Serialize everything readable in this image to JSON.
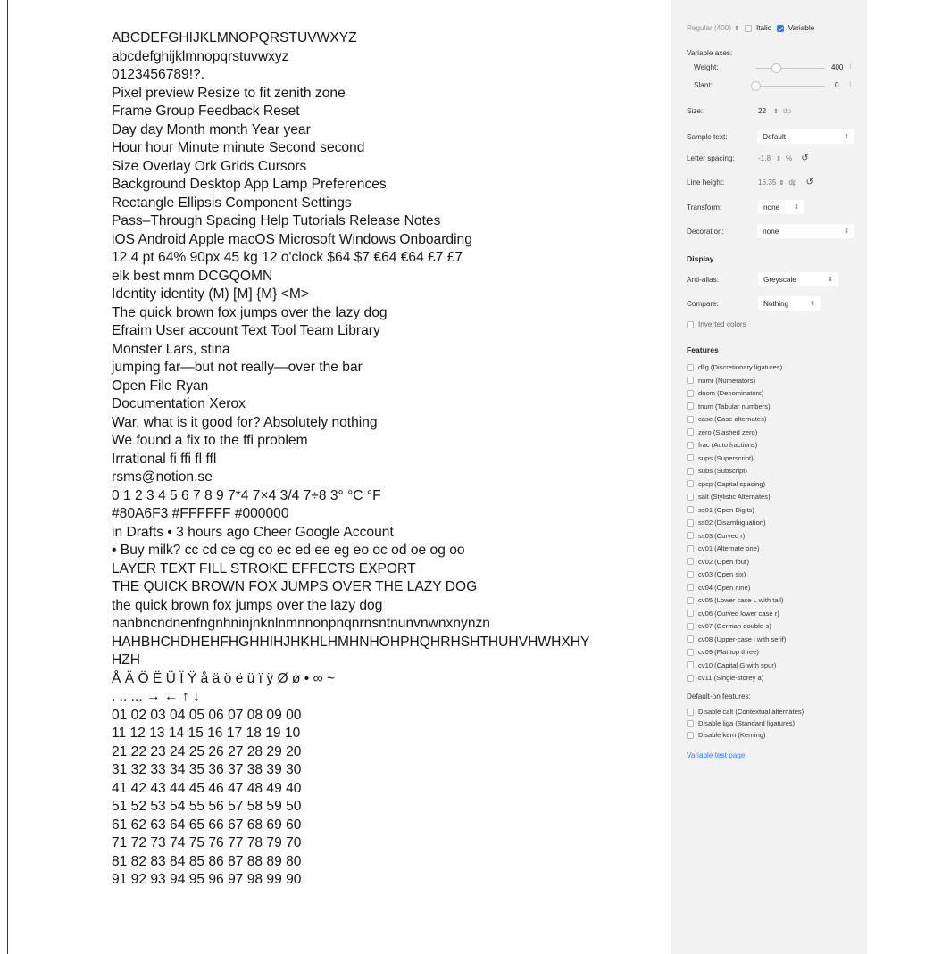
{
  "preview_lines": [
    "ABCDEFGHIJKLMNOPQRSTUVWXYZ",
    "abcdefghijklmnopqrstuvwxyz",
    "0123456789!?.",
    "Pixel preview  Resize to fit zenith zone",
    "Frame  Group  Feedback  Reset",
    "Day day  Month month  Year year",
    "Hour hour  Minute minute  Second second",
    "Size  Overlay  Ork  Grids  Cursors",
    "Background  Desktop App  Lamp  Preferences",
    "Rectangle  Ellipsis  Component  Settings",
    "Pass–Through  Spacing  Help  Tutorials  Release Notes",
    "iOS Android Apple macOS Microsoft Windows  Onboarding",
    "12.4 pt  64%  90px  45 kg  12 o'clock  $64 $7  €64 €64  £7 £7",
    "elk  best  mnm DCGQOMN",
    "Identity  identity (M) [M] {M} <M>",
    "The quick brown fox jumps over the lazy dog",
    "Efraim  User account  Text Tool  Team Library",
    "Monster  Lars, stina",
    "jumping far—but not really—over the bar",
    "Open File  Ryan",
    "Documentation  Xerox",
    "War, what is it good for? Absolutely nothing",
    "We found a fix to the ffi problem",
    "Irrational  fi  ffi  fl  ffl",
    "rsms@notion.se",
    "0 1 2 3 4 5 6 7 8 9  7*4  7×4  3/4  7÷8  3° °C °F",
    "#80A6F3  #FFFFFF  #000000",
    "in Drafts • 3 hours ago  Cheer Google Account",
    "• Buy milk?  cc cd ce cg co  ec ed ee eg eo  oc od oe og oo",
    "LAYER  TEXT  FILL  STROKE  EFFECTS  EXPORT",
    "THE QUICK BROWN FOX JUMPS OVER THE LAZY DOG",
    "the quick brown fox jumps over the lazy dog",
    "nanbncndnenfngnhninjnknlnmnnonpnqnrnsntnunvnwnxnynzn",
    "HAHBHCHDHEHFHGHHIHJHKHLHMHNHOHPHQHRHSHTHUHVHWHXHY",
    "HZH",
    "Å Ä Ö Ë Ü Ï Ÿ å ä ö ë ü ï ÿ Ø ø • ∞ ~",
    ". .. ... → ← ↑ ↓",
    "01 02 03 04 05 06 07 08 09 00",
    "11 12 13 14 15 16 17 18 19 10",
    "21 22 23 24 25 26 27 28 29 20",
    "31 32 33 34 35 36 37 38 39 30",
    "41 42 43 44 45 46 47 48 49 40",
    "51 52 53 54 55 56 57 58 59 50",
    "61 62 63 64 65 66 67 68 69 60",
    "71 72 73 74 75 76 77 78 79 70",
    "81 82 83 84 85 86 87 88 89 80",
    "91 92 93 94 95 96 97 98 99 90"
  ],
  "panel": {
    "weight_select": "Regular (400)",
    "italic_label": "Italic",
    "italic_checked": false,
    "variable_label": "Variable",
    "variable_checked": true,
    "variable_axes_label": "Variable axes:",
    "weight_label": "Weight:",
    "weight_value": "400",
    "weight_fraction": 0.3,
    "slant_label": "Slant:",
    "slant_value": "0",
    "slant_fraction": 0.0,
    "size_label": "Size:",
    "size_value": "22",
    "size_unit": "dp",
    "sample_text_label": "Sample text:",
    "sample_text_value": "Default",
    "letter_spacing_label": "Letter spacing:",
    "letter_spacing_value": "-1.8",
    "letter_spacing_unit": "%",
    "line_height_label": "Line height:",
    "line_height_value": "16.35",
    "line_height_unit": "dp",
    "transform_label": "Transform:",
    "transform_value": "none",
    "decoration_label": "Decoration:",
    "decoration_value": "none",
    "display_heading": "Display",
    "anti_alias_label": "Anti-alias:",
    "anti_alias_value": "Greyscale",
    "compare_label": "Compare:",
    "compare_value": "Nothing",
    "inverted_colors_label": "Inverted colors",
    "features_heading": "Features",
    "features": [
      "dlig  (Discretionary ligatures)",
      "numr  (Numerators)",
      "dnom  (Denominators)",
      "tnum  (Tabular numbers)",
      "case  (Case alternates)",
      "zero  (Slashed zero)",
      "frac  (Auto fractions)",
      "sups  (Superscript)",
      "subs  (Subscript)",
      "cpsp  (Capital spacing)",
      "salt  (Stylistic Alternates)",
      "ss01  (Open Digits)",
      "ss02  (Disambiguation)",
      "ss03  (Curved r)",
      "cv01  (Alternate one)",
      "cv02  (Open four)",
      "cv03  (Open six)",
      "cv04  (Open nine)",
      "cv05  (Lower case L with tail)",
      "cv06  (Curved lower case r)",
      "cv07  (German double-s)",
      "cv08  (Upper-case i with serif)",
      "cv09  (Flat top three)",
      "cv10  (Capital G with spur)",
      "cv11  (Single-storey a)"
    ],
    "default_on_heading": "Default-on features:",
    "default_on_features": [
      "Disable calt  (Contextual alternates)",
      "Disable liga  (Standard ligatures)",
      "Disable kern  (Kerning)"
    ],
    "variable_test_link": "Variable test page"
  },
  "colors": {
    "accent": "#2a7ef5",
    "panel_bg": "#f2f2f2"
  }
}
